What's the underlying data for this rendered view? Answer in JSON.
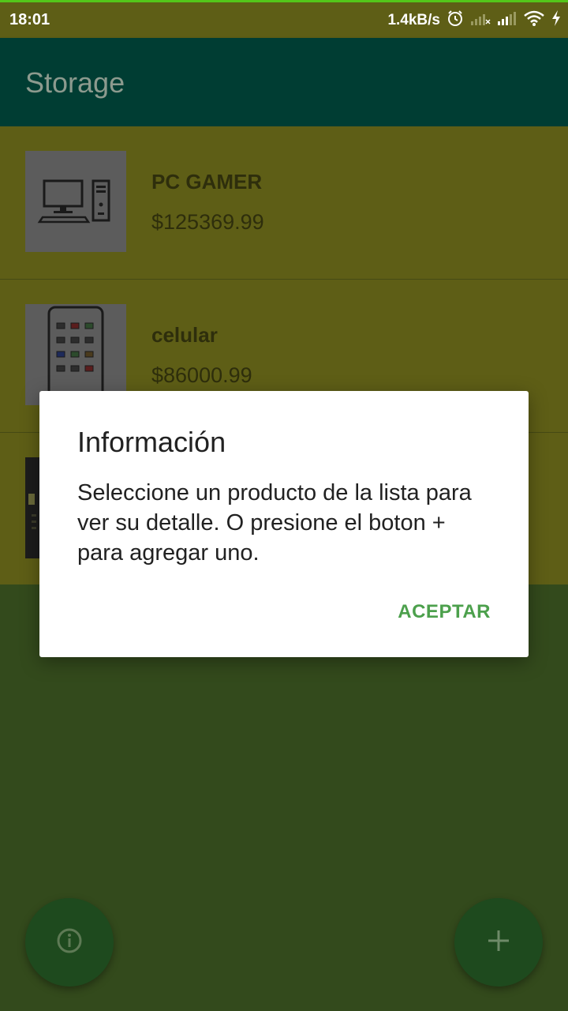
{
  "status_bar": {
    "time": "18:01",
    "net_speed": "1.4kB/s"
  },
  "app_bar": {
    "title": "Storage"
  },
  "products": [
    {
      "name": "PC GAMER",
      "price": "$125369.99",
      "icon": "desktop-computer-icon"
    },
    {
      "name": "celular",
      "price": "$86000.99",
      "icon": "smartphone-icon"
    },
    {
      "name": "",
      "price": "",
      "icon": "dark-product-thumbnail"
    }
  ],
  "dialog": {
    "title": "Información",
    "message": "Seleccione un producto de la lista para ver su detalle. O presione el boton + para agregar uno.",
    "accept_label": "ACEPTAR"
  },
  "fabs": {
    "info_icon": "info-icon",
    "add_icon": "plus-icon"
  },
  "colors": {
    "accent": "#4CA04C",
    "app_bar": "#003D33",
    "list_bg": "#5E5E16",
    "status_accent": "#54C51A"
  }
}
